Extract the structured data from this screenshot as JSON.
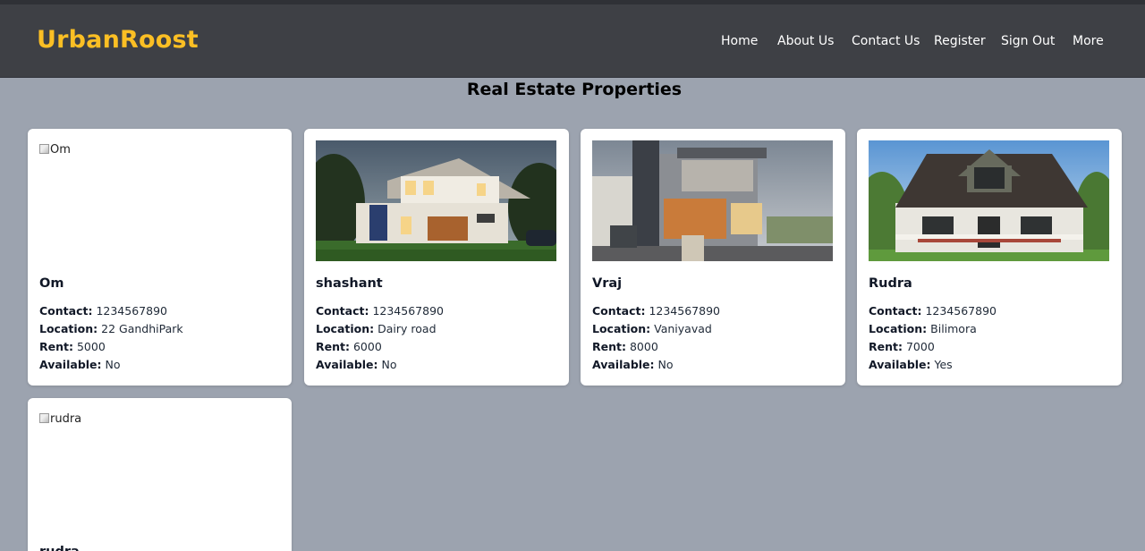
{
  "navbar": {
    "logo": "UrbanRoost",
    "links": [
      {
        "label": "Home"
      },
      {
        "label": "About Us"
      },
      {
        "label": "Contact Us"
      },
      {
        "label": "Register"
      },
      {
        "label": "Sign Out"
      },
      {
        "label": "More"
      }
    ]
  },
  "page": {
    "title": "Real Estate Properties"
  },
  "field_labels": {
    "contact": "Contact:",
    "location": "Location:",
    "rent": "Rent:",
    "available": "Available:"
  },
  "properties": [
    {
      "name": "Om",
      "image_alt": "Om",
      "image_loaded": false,
      "contact": "1234567890",
      "location": "22 GandhiPark",
      "rent": "5000",
      "available": "No"
    },
    {
      "name": "shashant",
      "image_alt": "shashant",
      "image_loaded": true,
      "contact": "1234567890",
      "location": "Dairy road",
      "rent": "6000",
      "available": "No"
    },
    {
      "name": "Vraj",
      "image_alt": "Vraj",
      "image_loaded": true,
      "contact": "1234567890",
      "location": "Vaniyavad",
      "rent": "8000",
      "available": "No"
    },
    {
      "name": "Rudra",
      "image_alt": "Rudra",
      "image_loaded": true,
      "contact": "1234567890",
      "location": "Bilimora",
      "rent": "7000",
      "available": "Yes"
    },
    {
      "name": "rudra",
      "image_alt": "rudra",
      "image_loaded": false
    }
  ],
  "colors": {
    "navbar_bg": "#3e4045",
    "logo": "#fbbf24",
    "page_bg": "#9ca3af",
    "card_bg": "#ffffff"
  }
}
